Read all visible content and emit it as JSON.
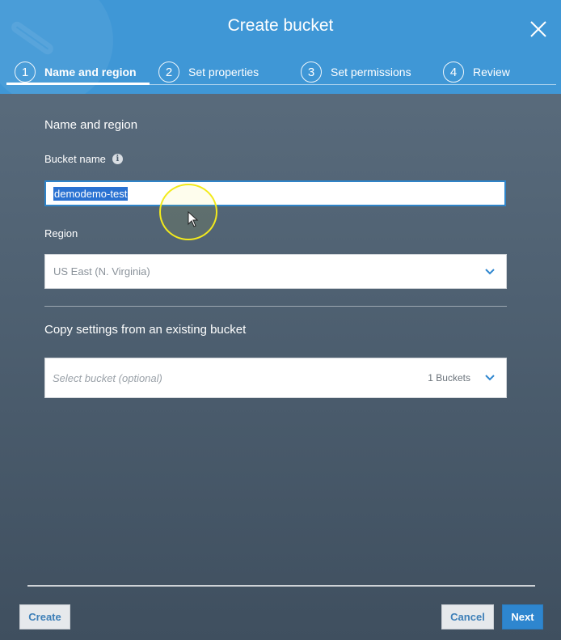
{
  "dialog": {
    "title": "Create bucket",
    "close_icon": "close-icon"
  },
  "steps": [
    {
      "number": "1",
      "label": "Name and region",
      "active": true
    },
    {
      "number": "2",
      "label": "Set properties",
      "active": false
    },
    {
      "number": "3",
      "label": "Set permissions",
      "active": false
    },
    {
      "number": "4",
      "label": "Review",
      "active": false
    }
  ],
  "form": {
    "section_title": "Name and region",
    "bucket_name_label": "Bucket name",
    "bucket_name_value": "demodemo-test",
    "region_label": "Region",
    "region_value": "US East (N. Virginia)",
    "copy_settings_title": "Copy settings from an existing bucket",
    "select_bucket_placeholder": "Select bucket (optional)",
    "bucket_count": "1 Buckets"
  },
  "footer": {
    "create_label": "Create",
    "cancel_label": "Cancel",
    "next_label": "Next"
  },
  "colors": {
    "header": "#3f97d6",
    "body_bg": "#4f6172",
    "primary_button": "#2e86cf",
    "cursor_highlight": "#f2ea1c"
  }
}
